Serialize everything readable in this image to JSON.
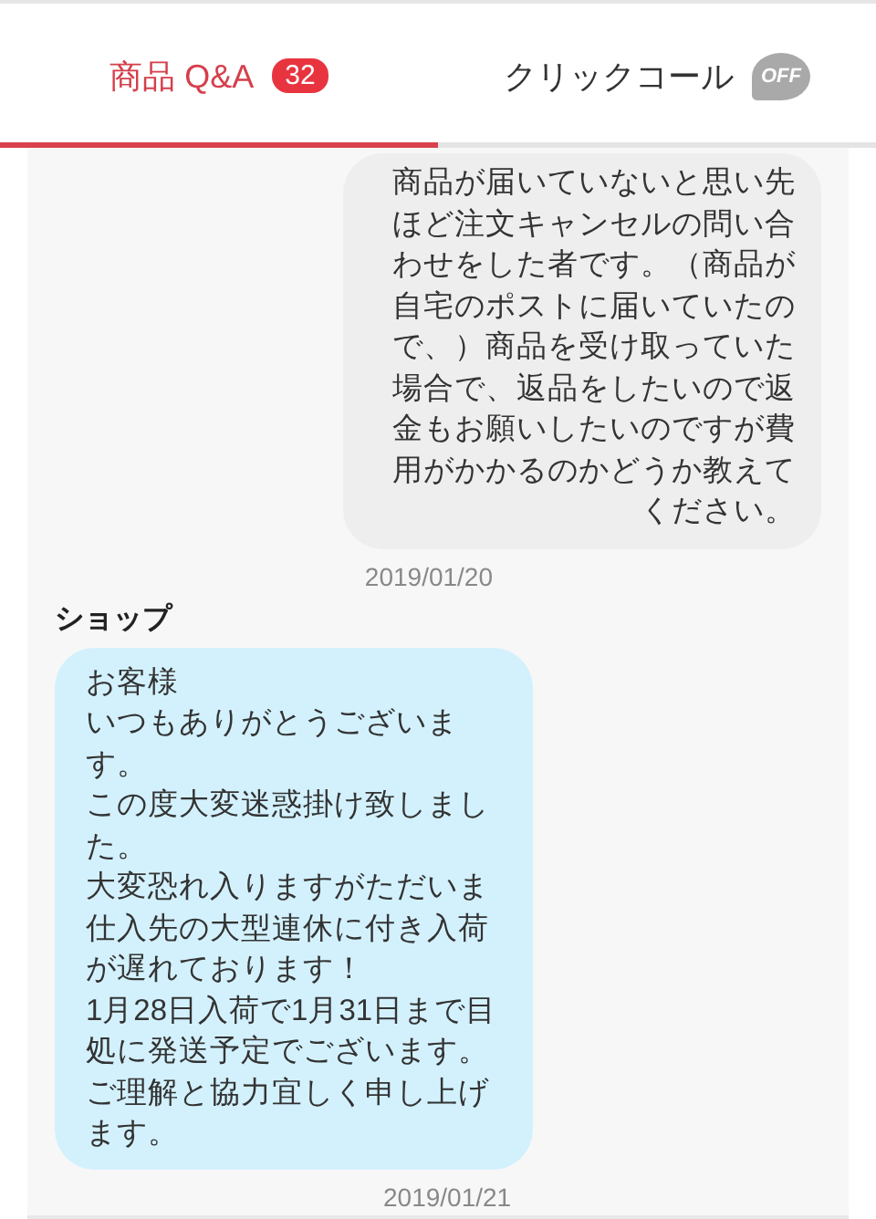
{
  "tabs": [
    {
      "label": "商品 Q&A",
      "badge": "32",
      "selected": true
    },
    {
      "label": "クリックコール",
      "toggle_label": "OFF",
      "selected": false
    }
  ],
  "messages": [
    {
      "kind": "outgoing",
      "text": "商品が届いていないと思い先ほど注文キャンセルの問い合わせをした者です。（商品が自宅のポストに届いていたので、）商品を受け取っていた場合で、返品をしたいので返金もお願いしたいのですが費用がかかるのかどうか教えてください。",
      "date": "2019/01/20"
    },
    {
      "kind": "incoming",
      "sender": "ショップ",
      "paragraphs": [
        "お客様",
        "いつもありがとうございます。",
        "この度大変迷惑掛け致しました。",
        "大変恐れ入りますがただいま仕入先の大型連休に付き入荷が遅れております！",
        "1月28日入荷で1月31日まで目処に発送予定でございます。",
        "ご理解と協力宜しく申し上げます。"
      ],
      "date": "2019/01/21"
    }
  ]
}
